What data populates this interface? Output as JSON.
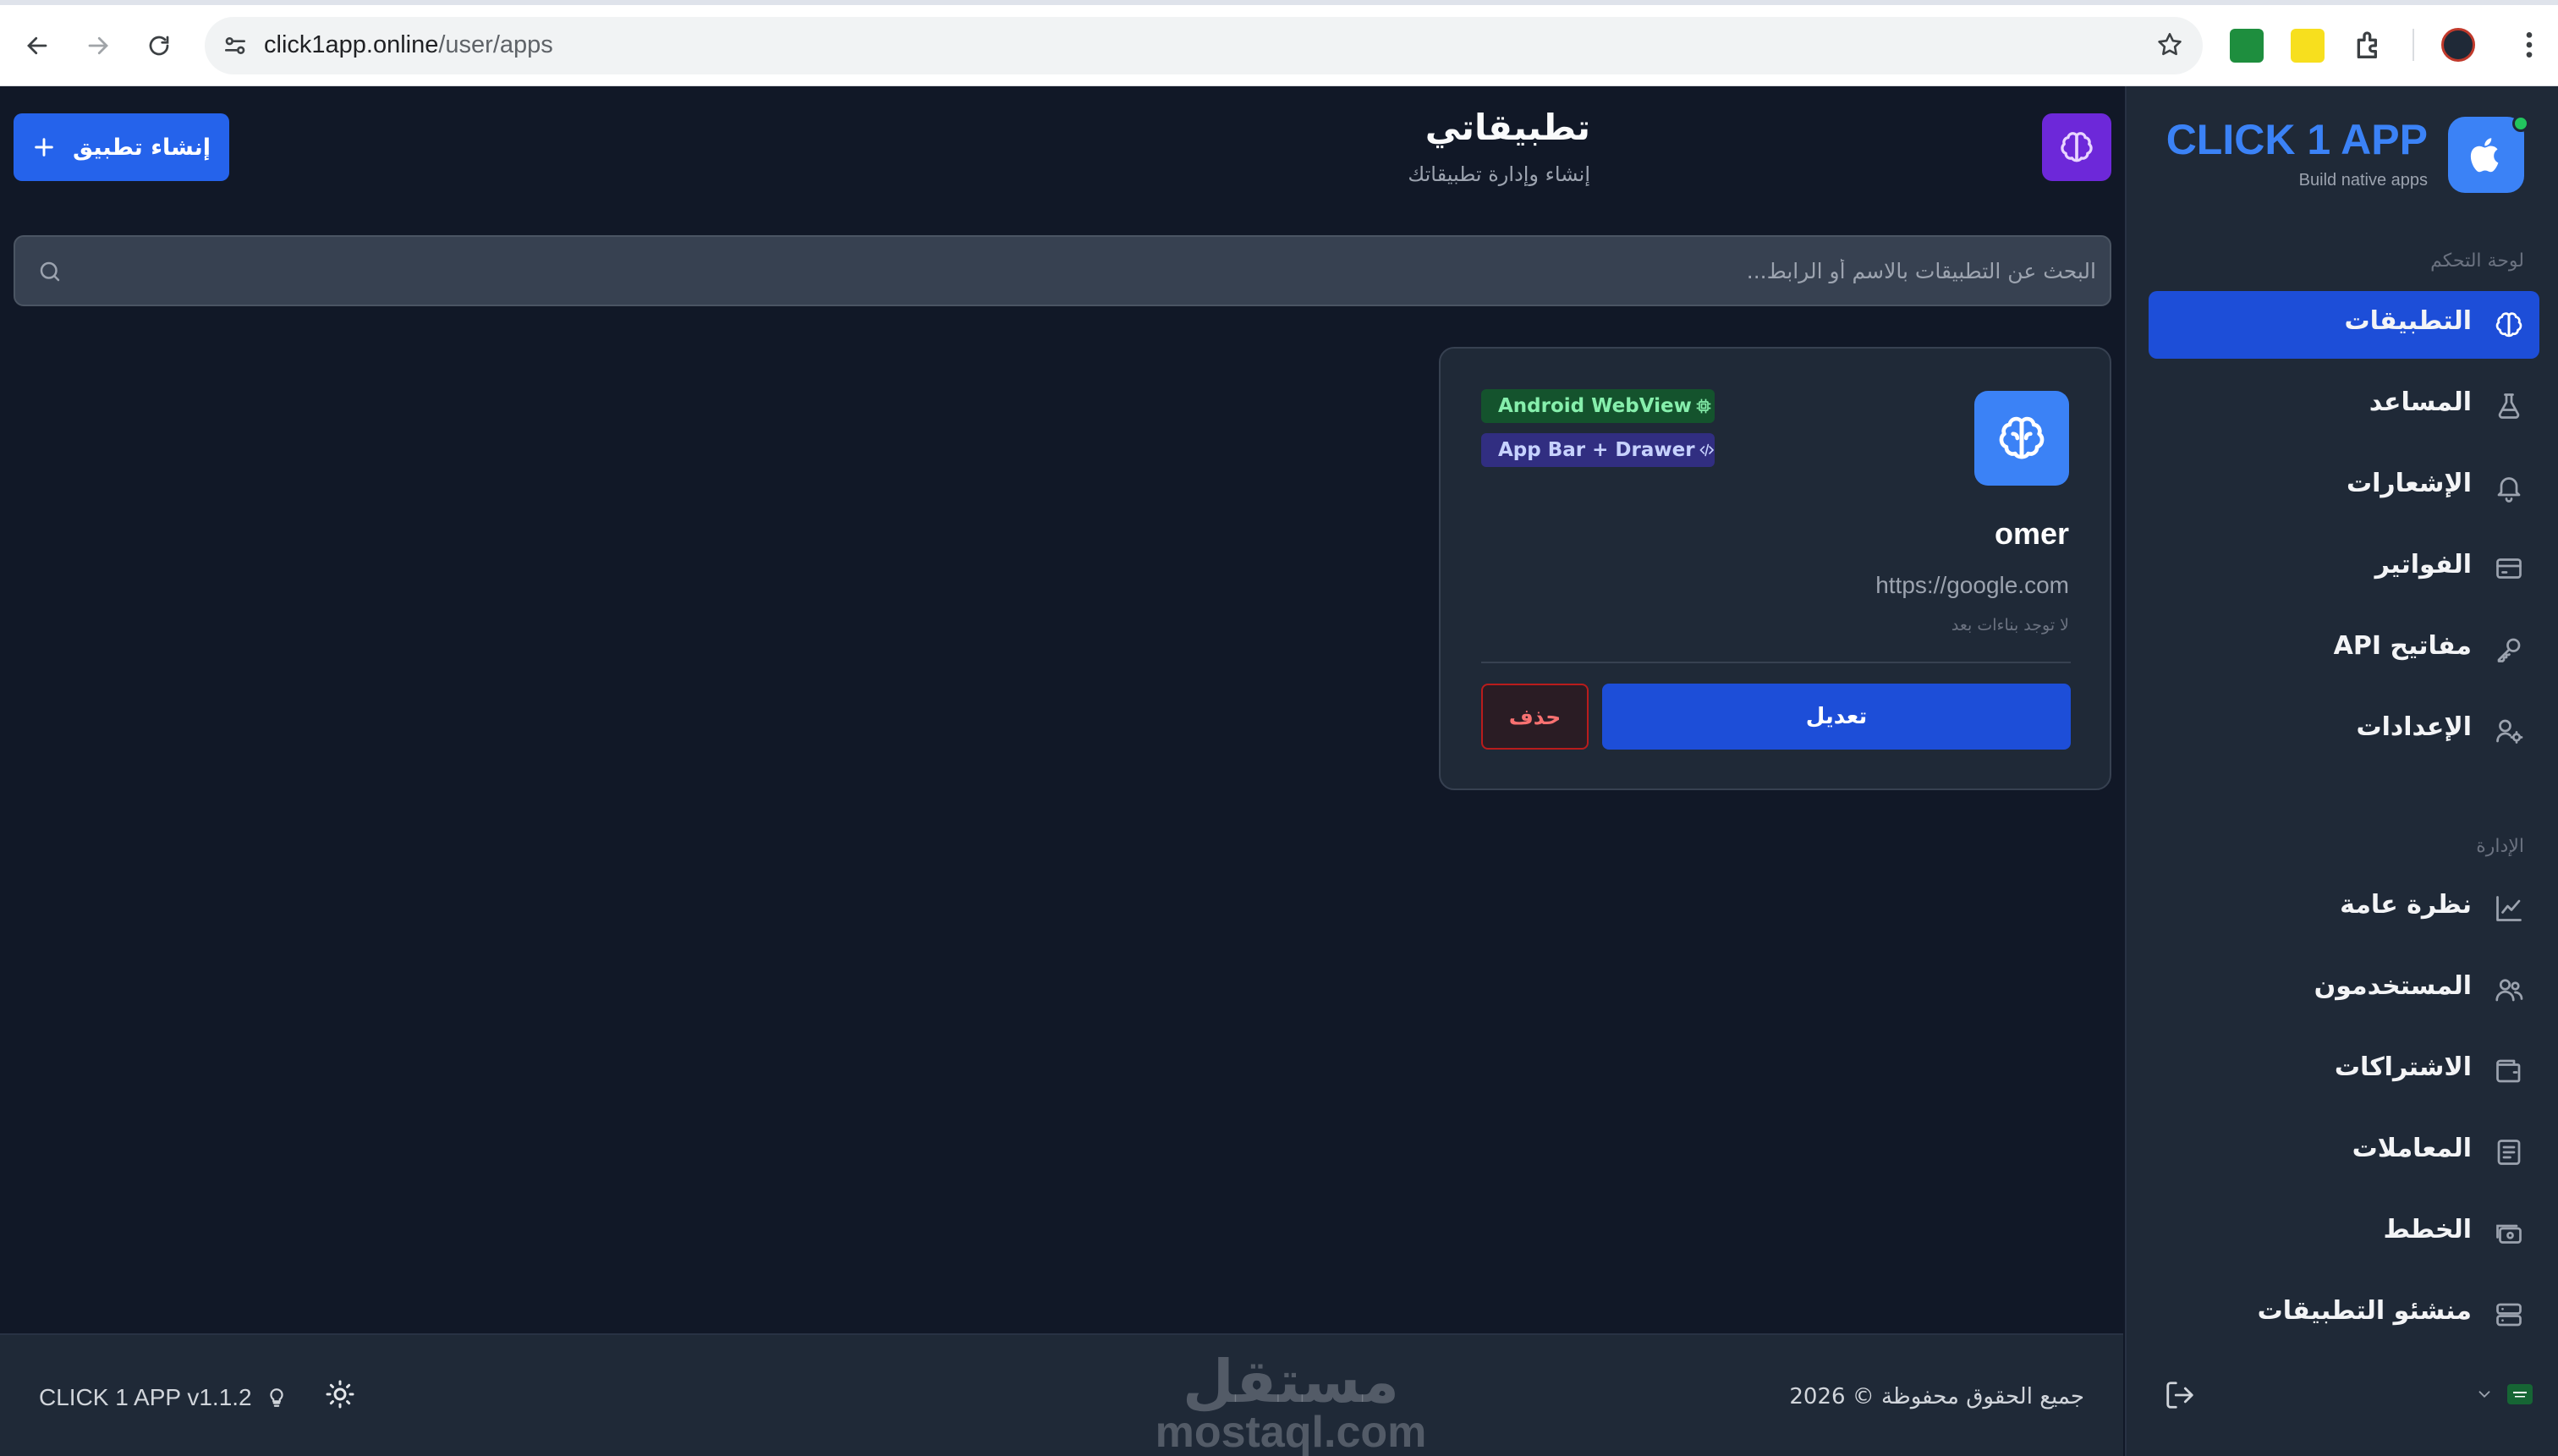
{
  "browser": {
    "url_host": "click1app.online",
    "url_path": "/user/apps"
  },
  "header": {
    "title": "تطبيقاتي",
    "subtitle": "إنشاء وإدارة تطبيقاتك",
    "create_button": "إنشاء تطبيق"
  },
  "search": {
    "placeholder": "البحث عن التطبيقات بالاسم أو الرابط..."
  },
  "apps": [
    {
      "name": "omer",
      "url": "https://google.com",
      "builds_status": "لا توجد بناءات بعد",
      "badges": [
        "Android WebView",
        "App Bar + Drawer"
      ],
      "edit_label": "تعديل",
      "delete_label": "حذف"
    }
  ],
  "footer": {
    "version": "CLICK 1 APP v1.1.2",
    "copyright": "جميع الحقوق محفوظة © 2026",
    "watermark_ar": "مستقل",
    "watermark_en": "mostaql.com"
  },
  "sidebar": {
    "brand_name": "CLICK 1 APP",
    "brand_tagline": "Build native apps",
    "section_dashboard": "لوحة التحكم",
    "section_admin": "الإدارة",
    "items": [
      {
        "label": "التطبيقات",
        "icon": "brain-icon",
        "active": true
      },
      {
        "label": "المساعد",
        "icon": "flask-icon"
      },
      {
        "label": "الإشعارات",
        "icon": "bell-icon"
      },
      {
        "label": "الفواتير",
        "icon": "credit-card-icon"
      },
      {
        "label": "مفاتيح API",
        "icon": "key-icon"
      },
      {
        "label": "الإعدادات",
        "icon": "user-cog-icon"
      },
      {
        "label": "نظرة عامة",
        "icon": "line-chart-icon"
      },
      {
        "label": "المستخدمون",
        "icon": "users-icon"
      },
      {
        "label": "الاشتراكات",
        "icon": "wallet-icon"
      },
      {
        "label": "المعاملات",
        "icon": "receipt-icon"
      },
      {
        "label": "الخطط",
        "icon": "banknote-icon"
      },
      {
        "label": "منشئو التطبيقات",
        "icon": "server-icon"
      }
    ]
  },
  "colors": {
    "accent": "#2563eb",
    "background": "#111827",
    "panel": "#1f2937",
    "brand": "#3b82f6",
    "danger": "#ef4444"
  }
}
